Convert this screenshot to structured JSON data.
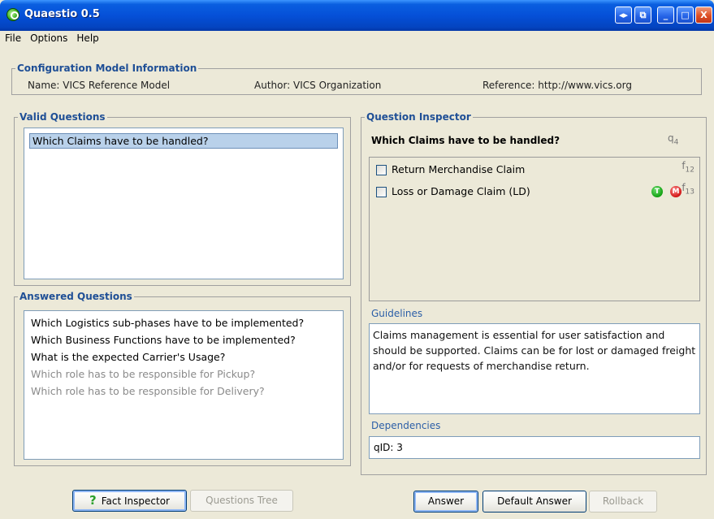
{
  "window": {
    "title": "Quaestio 0.5",
    "controls": [
      "◂▸",
      "⧉",
      "_",
      "□",
      "X"
    ]
  },
  "menu": [
    "File",
    "Options",
    "Help"
  ],
  "config": {
    "legend": "Configuration Model Information",
    "name": "Name: VICS Reference Model",
    "author": "Author: VICS Organization",
    "reference": "Reference: http://www.vics.org"
  },
  "valid_questions": {
    "legend": "Valid Questions",
    "items": [
      "Which Claims have to be handled?"
    ]
  },
  "answered_questions": {
    "legend": "Answered Questions",
    "items": [
      {
        "text": "Which Logistics sub-phases have to be implemented?",
        "dim": false
      },
      {
        "text": "Which Business Functions have to be implemented?",
        "dim": false
      },
      {
        "text": "What is the expected Carrier's Usage?",
        "dim": false
      },
      {
        "text": "Which role has to be responsible for Pickup?",
        "dim": true
      },
      {
        "text": "Which role has to be responsible for Delivery?",
        "dim": true
      }
    ]
  },
  "inspector": {
    "legend": "Question Inspector",
    "question": "Which Claims have to be handled?",
    "question_id": "q",
    "question_sub": "4",
    "facts": [
      {
        "label": "Return Merchandise Claim",
        "id": "f",
        "sub": "12",
        "badges": []
      },
      {
        "label": "Loss or Damage Claim (LD)",
        "id": "f",
        "sub": "13",
        "badges": [
          "T",
          "M"
        ]
      }
    ],
    "guidelines_label": "Guidelines",
    "guidelines": "Claims management is essential for user satisfaction and should be supported. Claims can be for lost or damaged freight and/or for requests of merchandise return.",
    "dependencies_label": "Dependencies",
    "dependencies": "qID: 3"
  },
  "buttons": {
    "fact_inspector": "Fact Inspector",
    "fact_inspector_icon": "?",
    "questions_tree": "Questions Tree",
    "answer": "Answer",
    "default_answer": "Default Answer",
    "rollback": "Rollback"
  }
}
